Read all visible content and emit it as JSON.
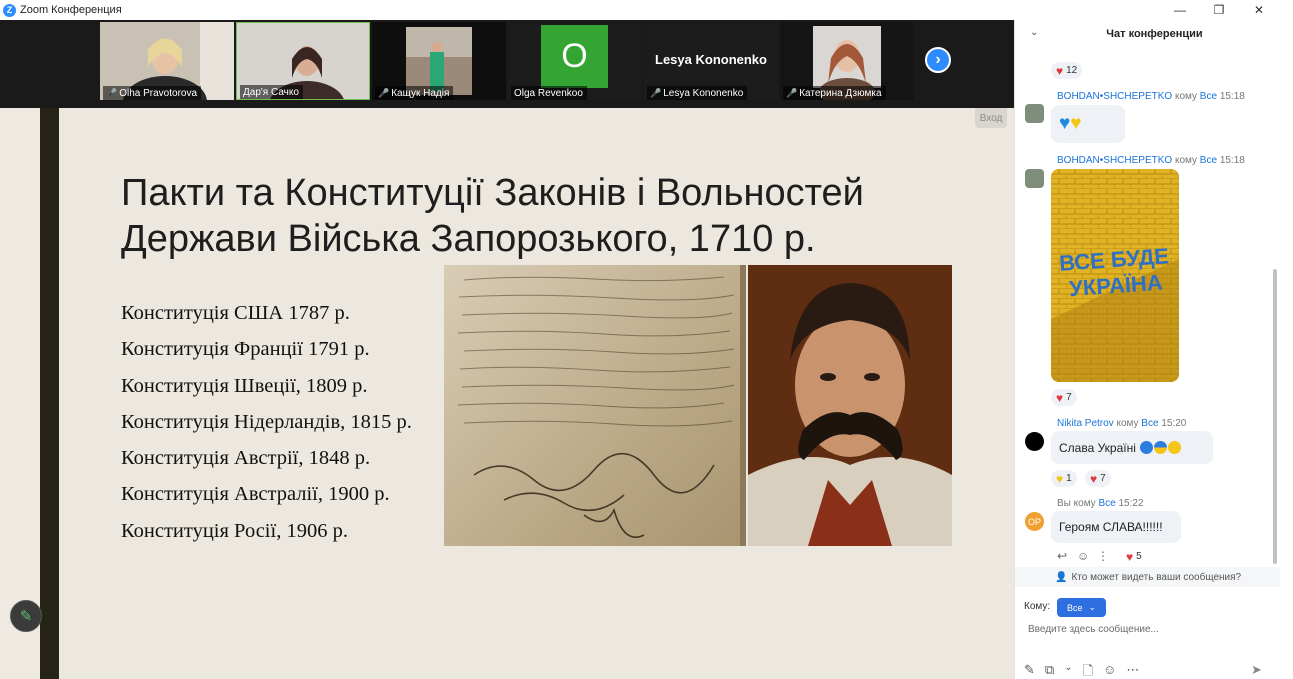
{
  "window": {
    "title": "Zoom Конференция",
    "minimize": "—",
    "maximize": "❐",
    "close": "✕"
  },
  "participants": [
    {
      "name": "Olha Pravotorova",
      "muted": true
    },
    {
      "name": "Дар'я Сачко",
      "muted": false
    },
    {
      "name": "Кащук Надія",
      "muted": true
    },
    {
      "name": "Olga Revenkoo",
      "initial": "O",
      "muted": false
    },
    {
      "name": "Lesya Kononenko",
      "bigname": "Lesya Kononenko",
      "muted": true
    },
    {
      "name": "Катерина Дзюмка",
      "muted": true
    }
  ],
  "strip": {
    "next_icon": "chevron-right-icon"
  },
  "slide": {
    "enter_label": "Вход",
    "title_line1": "Пакти та Конституції Законів і Вольностей",
    "title_line2": "Держави Війська Запорозького, 1710 р.",
    "list": [
      "Конституція США 1787 р.",
      "Конституція Франції 1791 р.",
      "Конституція Швеції, 1809 р.",
      "Конституція Нідерландів, 1815 р.",
      "Конституція Австрії, 1848 р.",
      "Конституція Австралії, 1900 р.",
      "Конституція Росії, 1906 р."
    ]
  },
  "chat": {
    "title": "Чат конференции",
    "messages": {
      "r1": "12",
      "m1": {
        "sender": "BOHDAN•SHCHEPETKO",
        "to": "кому",
        "target": "Все",
        "time": "15:18"
      },
      "m2": {
        "sender": "BOHDAN•SHCHEPETKO",
        "to": "кому",
        "target": "Все",
        "time": "15:18",
        "image_text1": "ВСЕ БУДЕ",
        "image_text2": "УКРАЇНА"
      },
      "r2": "7",
      "m3": {
        "sender": "Nikita Petrov",
        "to": "кому",
        "target": "Все",
        "time": "15:20",
        "text": "Слава Україні"
      },
      "r3a": "1",
      "r3b": "7",
      "m4": {
        "sender": "Вы",
        "to": "кому",
        "target": "Все",
        "time": "15:22",
        "text": "Героям СЛАВА!!!!!!",
        "avatar": "OP"
      },
      "r4": "5"
    },
    "who_can_see": "Кто может видеть ваши сообщения?",
    "to_label": "Кому:",
    "to_value": "Все",
    "input_placeholder": "Введите здесь сообщение..."
  },
  "colors": {
    "accent": "#2d8cff",
    "heart": "#e0393e",
    "link": "#1a73d9"
  }
}
